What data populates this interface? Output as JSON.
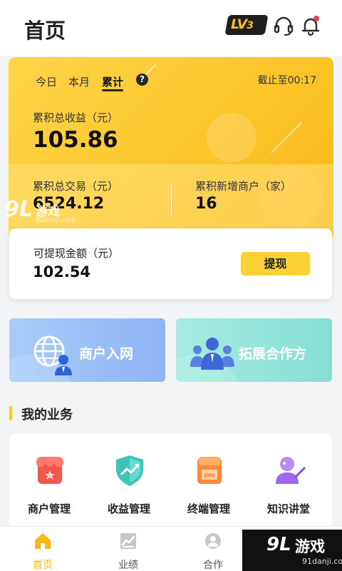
{
  "header": {
    "title": "首页",
    "level_badge": {
      "prefix": "LV",
      "number": "3"
    },
    "icons": [
      "headset-icon",
      "bell-icon"
    ],
    "bell_has_notification": true
  },
  "stats": {
    "tabs": [
      {
        "label": "今日",
        "active": false
      },
      {
        "label": "本月",
        "active": false
      },
      {
        "label": "累计",
        "active": true
      }
    ],
    "help_glyph": "?",
    "as_of": "截止至00:17",
    "total_income_label": "累积总收益（元）",
    "total_income_value": "105.86",
    "total_volume_label": "累积总交易（元）",
    "total_volume_value": "6524.12",
    "new_merchants_label": "累积新增商户（家）",
    "new_merchants_value": "16"
  },
  "withdraw": {
    "label": "可提现金额（元）",
    "value": "102.54",
    "button_label": "提现"
  },
  "tiles": [
    {
      "label": "商户入网",
      "icon": "globe-person-icon"
    },
    {
      "label": "拓展合作方",
      "icon": "team-icon"
    }
  ],
  "business": {
    "title": "我的业务",
    "items": [
      {
        "label": "商户管理",
        "icon": "store-icon"
      },
      {
        "label": "收益管理",
        "icon": "shield-chart-icon"
      },
      {
        "label": "终端管理",
        "icon": "pos-terminal-icon"
      },
      {
        "label": "知识讲堂",
        "icon": "lecture-icon"
      }
    ]
  },
  "bottom_nav": {
    "items": [
      {
        "label": "首页",
        "icon": "home-icon",
        "active": true
      },
      {
        "label": "业绩",
        "icon": "chart-icon",
        "active": false
      },
      {
        "label": "合作",
        "icon": "partner-icon",
        "active": false
      }
    ]
  },
  "watermark": {
    "brand_num": "9L",
    "brand_cn": "游戏",
    "url": "91danji.com"
  },
  "colors": {
    "accent": "#fbc92a",
    "accent_dark": "#f7b719",
    "tile_blue": "#9bc2f7",
    "tile_teal": "#93e5da",
    "notification_dot": "#f23c3c"
  }
}
